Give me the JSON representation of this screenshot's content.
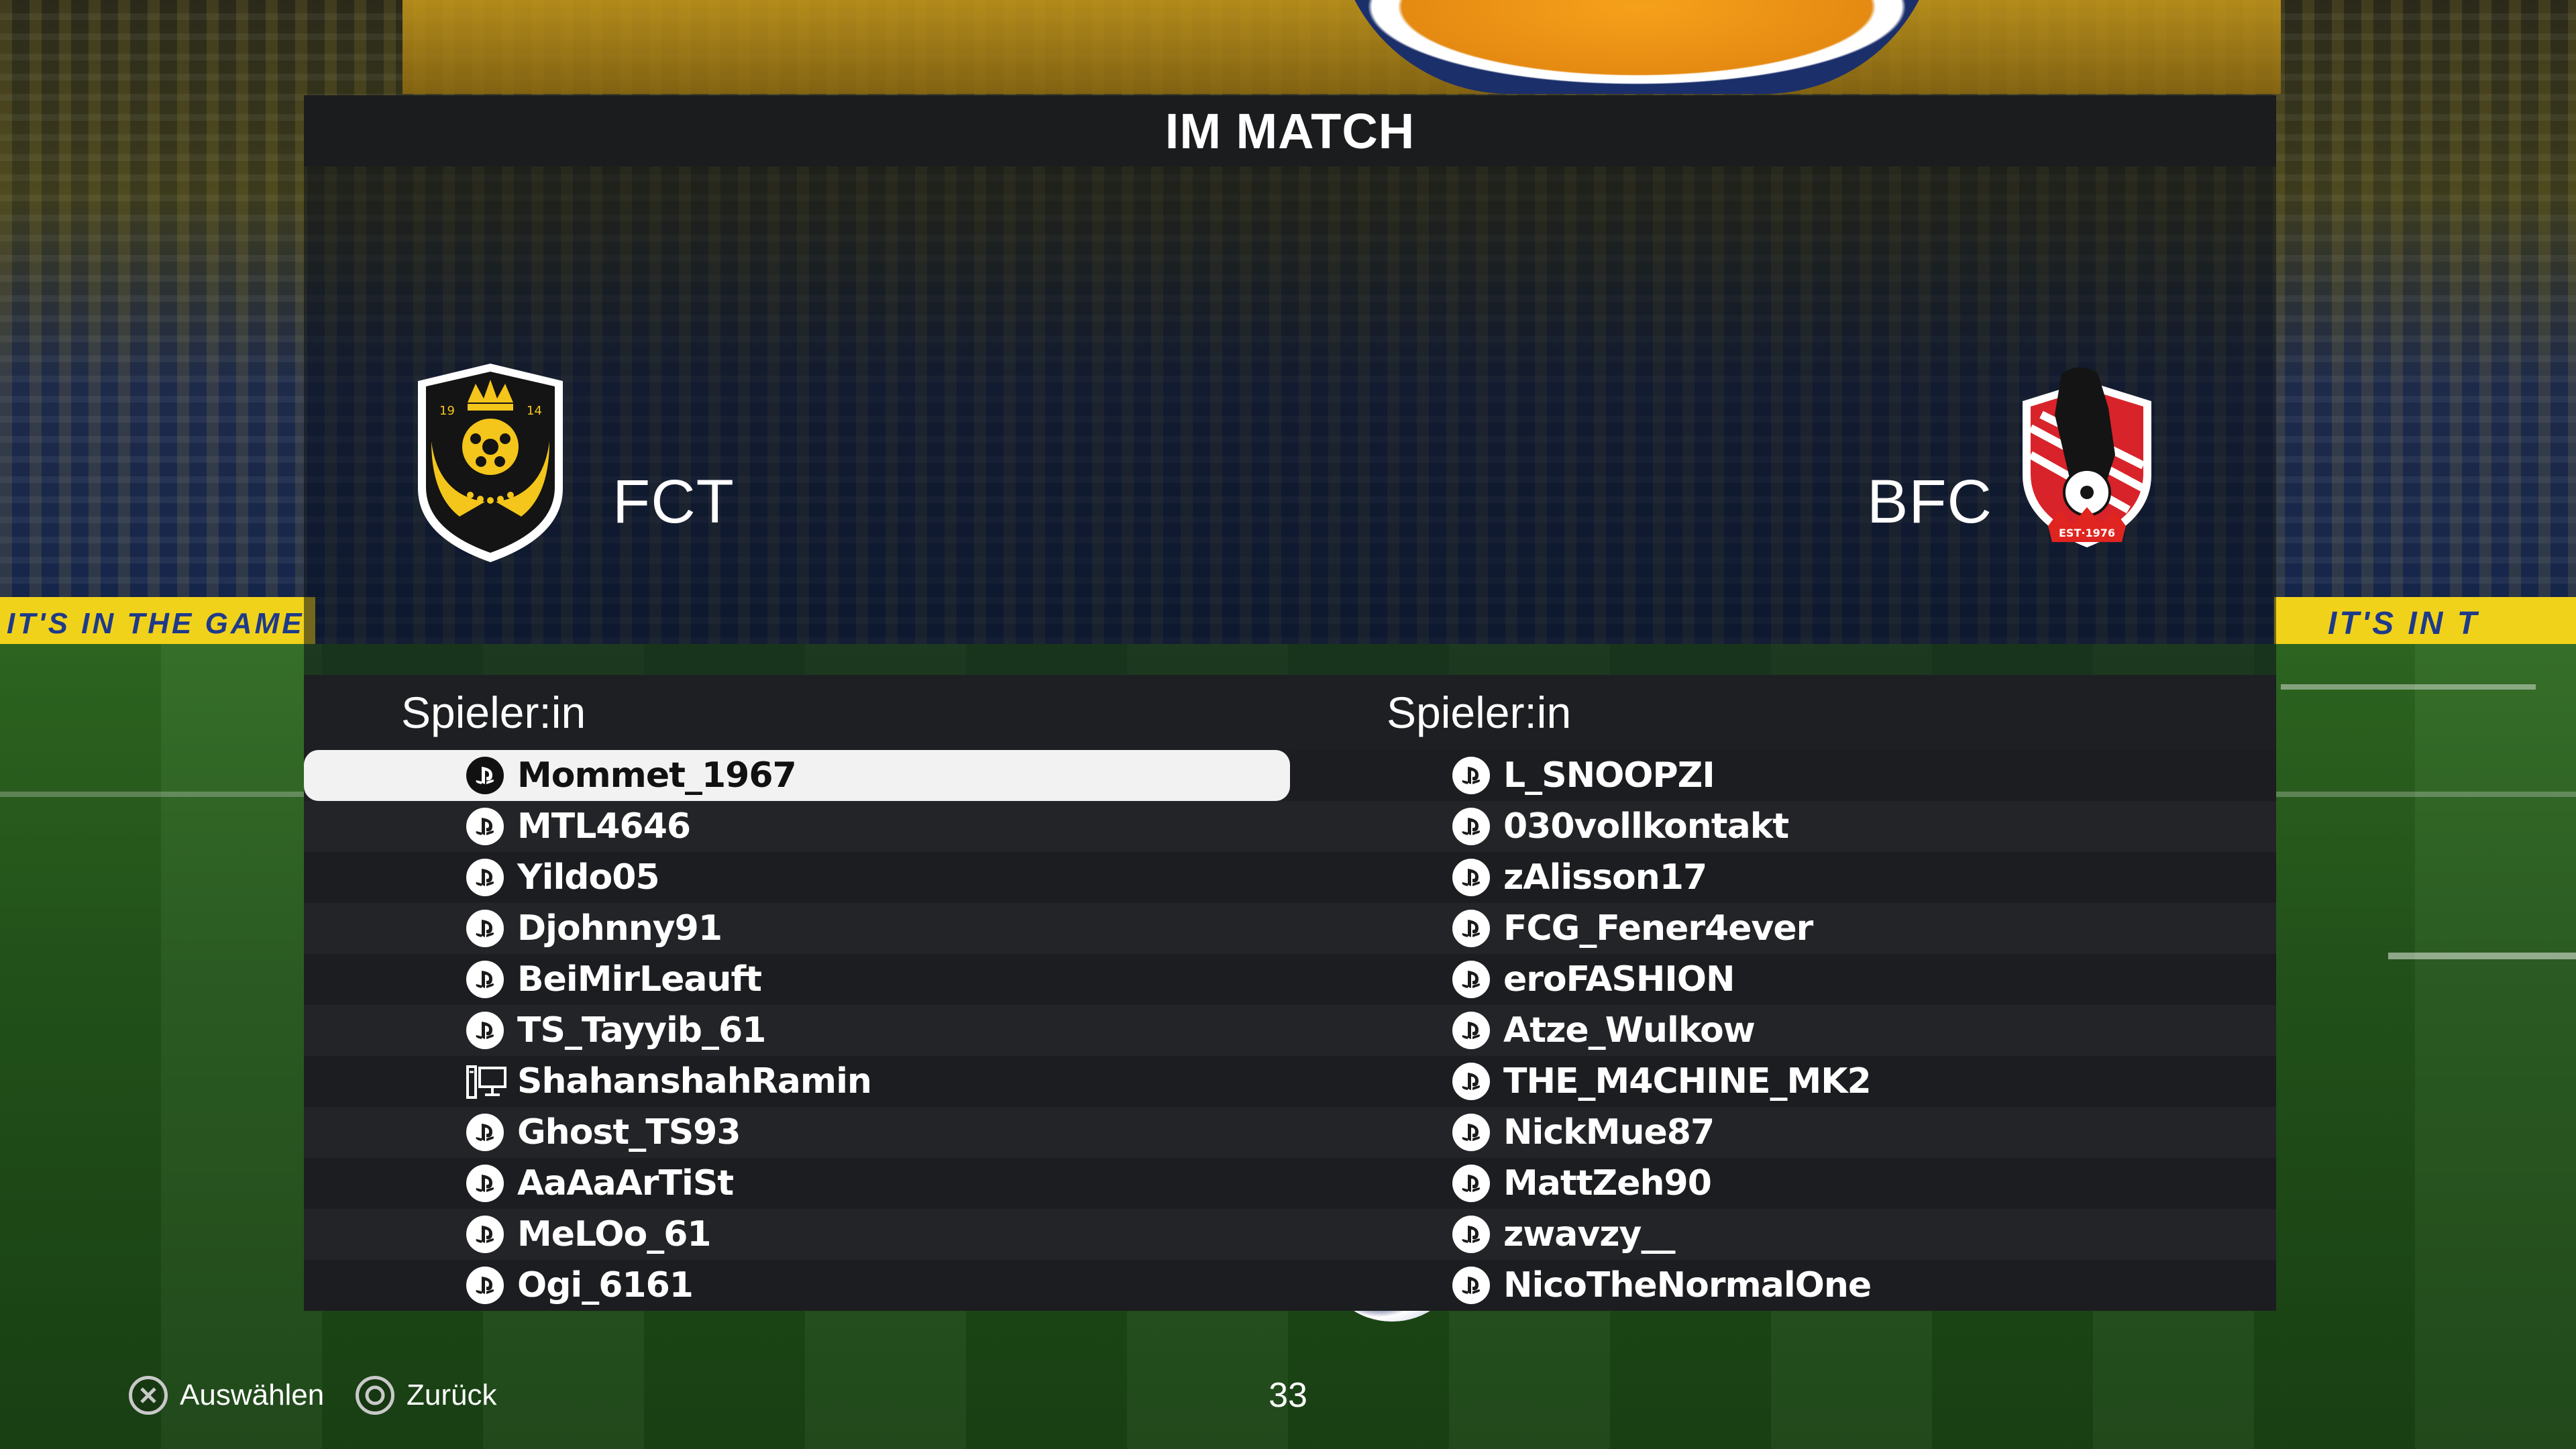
{
  "title": "IM MATCH",
  "home": {
    "name": "FCT",
    "column_header": "Spieler:in",
    "players": [
      {
        "name": "Mommet_1967",
        "platform": "playstation-icon",
        "selected": true
      },
      {
        "name": "MTL4646",
        "platform": "playstation-icon"
      },
      {
        "name": "Yildo05",
        "platform": "playstation-icon"
      },
      {
        "name": "Djohnny91",
        "platform": "playstation-icon"
      },
      {
        "name": "BeiMirLeauft",
        "platform": "playstation-icon"
      },
      {
        "name": "TS_Tayyib_61",
        "platform": "playstation-icon"
      },
      {
        "name": "ShahanshahRamin",
        "platform": "pc-icon"
      },
      {
        "name": "Ghost_TS93",
        "platform": "playstation-icon"
      },
      {
        "name": "AaAaArTiSt",
        "platform": "playstation-icon"
      },
      {
        "name": "MeLOo_61",
        "platform": "playstation-icon"
      },
      {
        "name": "Ogi_6161",
        "platform": "playstation-icon"
      }
    ]
  },
  "away": {
    "name": "BFC",
    "column_header": "Spieler:in",
    "players": [
      {
        "name": "L_SNOOPZI",
        "platform": "playstation-icon"
      },
      {
        "name": "030vollkontakt",
        "platform": "playstation-icon"
      },
      {
        "name": "zAlisson17",
        "platform": "playstation-icon"
      },
      {
        "name": "FCG_Fener4ever",
        "platform": "playstation-icon"
      },
      {
        "name": "eroFASHION",
        "platform": "playstation-icon"
      },
      {
        "name": "Atze_Wulkow",
        "platform": "playstation-icon"
      },
      {
        "name": "THE_M4CHINE_MK2",
        "platform": "playstation-icon"
      },
      {
        "name": "NickMue87",
        "platform": "playstation-icon"
      },
      {
        "name": "MattZeh90",
        "platform": "playstation-icon"
      },
      {
        "name": "zwavzy__",
        "platform": "playstation-icon"
      },
      {
        "name": "NicoTheNormalOne",
        "platform": "playstation-icon"
      }
    ]
  },
  "home_crest": {
    "numbers": [
      "19",
      "14"
    ]
  },
  "away_crest": {
    "text": "EST·1976"
  },
  "footer": {
    "select_label": "Auswählen",
    "select_icon": "cross-button-icon",
    "back_label": "Zurück",
    "back_icon": "circle-button-icon",
    "counter": "33"
  },
  "background": {
    "adboard_left": "IT'S IN THE GAME",
    "adboard_right": "IT'S IN T"
  },
  "colors": {
    "panel_dark": "#1b1c1e",
    "row_selected": "#f2f2f2",
    "home_crest_gold": "#f4c51a",
    "away_crest_red": "#d8232a"
  }
}
